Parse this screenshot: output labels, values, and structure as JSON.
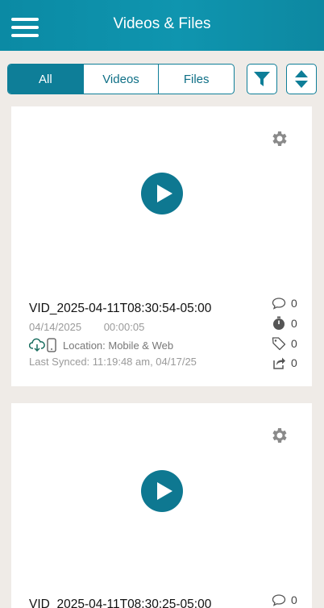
{
  "header": {
    "title": "Videos & Files",
    "menu_icon": "hamburger-menu-icon"
  },
  "tabs": [
    {
      "label": "All",
      "active": true
    },
    {
      "label": "Videos",
      "active": false
    },
    {
      "label": "Files",
      "active": false
    }
  ],
  "toolbar": {
    "filter_icon": "filter-icon",
    "sort_icon": "sort-icon"
  },
  "colors": {
    "accent": "#0e7e98",
    "header": "#0f95af",
    "background": "#efebe7"
  },
  "items": [
    {
      "title": "VID_2025-04-11T08:30:54-05:00",
      "date": "04/14/2025",
      "duration": "00:00:05",
      "location": "Location: Mobile & Web",
      "last_synced": "Last Synced: 11:19:48 am, 04/17/25",
      "comments": "0",
      "timers": "0",
      "tags": "0",
      "shares": "0"
    },
    {
      "title": "VID_2025-04-11T08:30:25-05:00",
      "comments": "0"
    }
  ]
}
